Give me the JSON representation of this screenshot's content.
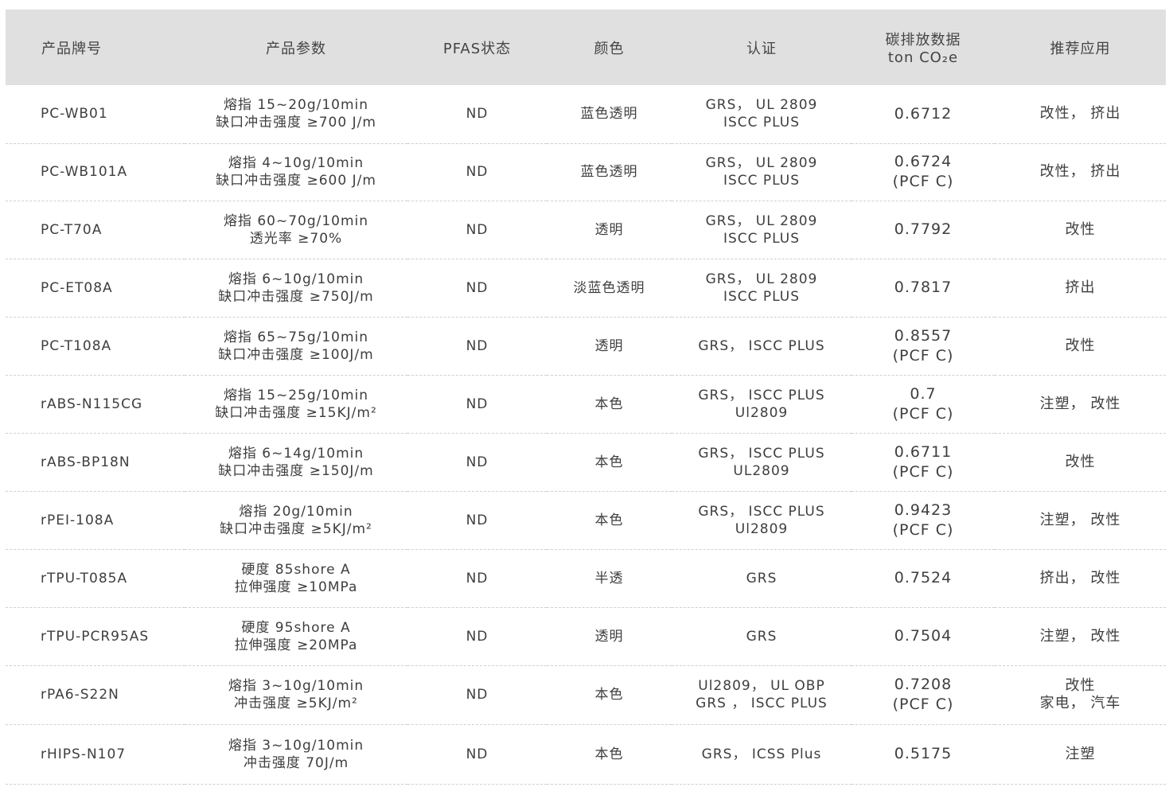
{
  "watermark": "",
  "header": {
    "brand": "产品牌号",
    "params": "产品参数",
    "pfas": "PFAS状态",
    "color": "颜色",
    "cert": "认证",
    "carbon_line1": "碳排放数据",
    "carbon_line2": "ton CO₂e",
    "application": "推荐应用"
  },
  "rows": [
    {
      "brand": "PC-WB01",
      "params": [
        "熔指 15~20g/10min",
        "缺口冲击强度 ≥700 J/m"
      ],
      "pfas": "ND",
      "color": "蓝色透明",
      "cert": [
        "GRS， UL 2809",
        "ISCC PLUS"
      ],
      "carbon": [
        "0.6712"
      ],
      "app": [
        "改性， 挤出"
      ]
    },
    {
      "brand": "PC-WB101A",
      "params": [
        "熔指 4~10g/10min",
        "缺口冲击强度 ≥600 J/m"
      ],
      "pfas": "ND",
      "color": "蓝色透明",
      "cert": [
        "GRS， UL 2809",
        "ISCC PLUS"
      ],
      "carbon": [
        "0.6724",
        "(PCF C)"
      ],
      "app": [
        "改性， 挤出"
      ]
    },
    {
      "brand": "PC-T70A",
      "params": [
        "熔指 60~70g/10min",
        "透光率 ≥70%"
      ],
      "pfas": "ND",
      "color": "透明",
      "cert": [
        "GRS， UL 2809",
        "ISCC PLUS"
      ],
      "carbon": [
        "0.7792"
      ],
      "app": [
        "改性"
      ]
    },
    {
      "brand": "PC-ET08A",
      "params": [
        "熔指 6~10g/10min",
        "缺口冲击强度 ≥750J/m"
      ],
      "pfas": "ND",
      "color": "淡蓝色透明",
      "cert": [
        "GRS， UL 2809",
        "ISCC PLUS"
      ],
      "carbon": [
        "0.7817"
      ],
      "app": [
        "挤出"
      ]
    },
    {
      "brand": "PC-T108A",
      "params": [
        "熔指 65~75g/10min",
        "缺口冲击强度 ≥100J/m"
      ],
      "pfas": "ND",
      "color": "透明",
      "cert": [
        "GRS， ISCC PLUS"
      ],
      "carbon": [
        "0.8557",
        "(PCF C)"
      ],
      "app": [
        "改性"
      ]
    },
    {
      "brand": "rABS-N115CG",
      "params": [
        "熔指 15~25g/10min",
        "缺口冲击强度 ≥15KJ/m²"
      ],
      "pfas": "ND",
      "color": "本色",
      "cert": [
        "GRS， ISCC PLUS",
        "Ul2809"
      ],
      "carbon": [
        "0.7",
        "(PCF C)"
      ],
      "app": [
        "注塑， 改性"
      ]
    },
    {
      "brand": "rABS-BP18N",
      "params": [
        "熔指 6~14g/10min",
        "缺口冲击强度 ≥150J/m"
      ],
      "pfas": "ND",
      "color": "本色",
      "cert": [
        "GRS， ISCC PLUS",
        "UL2809"
      ],
      "carbon": [
        "0.6711",
        "(PCF C)"
      ],
      "app": [
        "改性"
      ]
    },
    {
      "brand": "rPEI-108A",
      "params": [
        "熔指 20g/10min",
        "缺口冲击强度 ≥5KJ/m²"
      ],
      "pfas": "ND",
      "color": "本色",
      "cert": [
        "GRS， ISCC PLUS",
        "Ul2809"
      ],
      "carbon": [
        "0.9423",
        "(PCF C)"
      ],
      "app": [
        "注塑， 改性"
      ]
    },
    {
      "brand": "rTPU-T085A",
      "params": [
        "硬度 85shore A",
        "拉伸强度 ≥10MPa"
      ],
      "pfas": "ND",
      "color": "半透",
      "cert": [
        "GRS"
      ],
      "carbon": [
        "0.7524"
      ],
      "app": [
        "挤出， 改性"
      ]
    },
    {
      "brand": "rTPU-PCR95AS",
      "params": [
        "硬度 95shore A",
        "拉伸强度 ≥20MPa"
      ],
      "pfas": "ND",
      "color": "透明",
      "cert": [
        "GRS"
      ],
      "carbon": [
        "0.7504"
      ],
      "app": [
        "注塑， 改性"
      ]
    },
    {
      "brand": "rPA6-S22N",
      "params": [
        "熔指 3~10g/10min",
        "冲击强度 ≥5KJ/m²"
      ],
      "pfas": "ND",
      "color": "本色",
      "cert": [
        "Ul2809， UL OBP",
        "GRS ， ISCC PLUS"
      ],
      "carbon": [
        "0.7208",
        "(PCF C)"
      ],
      "app": [
        "改性",
        "家电， 汽车"
      ]
    },
    {
      "brand": "rHIPS-N107",
      "params": [
        "熔指 3~10g/10min",
        "冲击强度 70J/m"
      ],
      "pfas": "ND",
      "color": "本色",
      "cert": [
        "GRS， ICSS Plus"
      ],
      "carbon": [
        "0.5175"
      ],
      "app": [
        "注塑"
      ]
    }
  ]
}
